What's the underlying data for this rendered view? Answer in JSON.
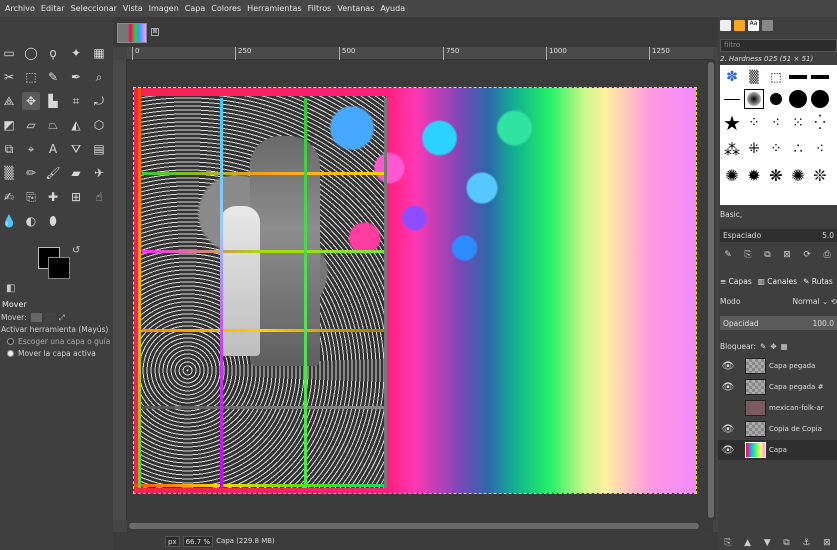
{
  "menu": [
    "Archivo",
    "Editar",
    "Seleccionar",
    "Vista",
    "Imagen",
    "Capa",
    "Colores",
    "Herramientas",
    "Filtros",
    "Ventanas",
    "Ayuda"
  ],
  "tool_options": {
    "title": "Mover",
    "move_label": "Mover:",
    "toggle_label": "Activar herramienta (Mayús)",
    "option1": "Escoger una capa o guía",
    "option2": "Mover la capa activa"
  },
  "ruler": {
    "ticks": [
      "0",
      "250",
      "500",
      "750",
      "1000",
      "1250"
    ]
  },
  "status": {
    "unit": "px",
    "zoom": "66.7 %",
    "info": "Capa (229.8 MB)"
  },
  "tab": {
    "close": "⊠"
  },
  "brushes": {
    "filter_placeholder": "filtro",
    "name": "2. Hardness 025 (51 × 51)",
    "preset": "Basic,",
    "spacing_label": "Espaciado",
    "spacing_value": "5.0"
  },
  "layers_panel": {
    "tabs": [
      "Capas",
      "Canales",
      "Rutas"
    ],
    "mode_label": "Modo",
    "mode_value": "Normal",
    "opacity_label": "Opacidad",
    "opacity_value": "100.0",
    "lock_label": "Bloquear:",
    "layers": [
      {
        "name": "Capa pegada",
        "visible": true
      },
      {
        "name": "Capa pegada #",
        "visible": true
      },
      {
        "name": "mexican-folk-ar",
        "visible": false
      },
      {
        "name": "Copia de Copia",
        "visible": true
      },
      {
        "name": "Capa",
        "visible": true
      }
    ]
  },
  "colors": {
    "accent": "#ffe800",
    "panel": "#3f3f3f"
  }
}
